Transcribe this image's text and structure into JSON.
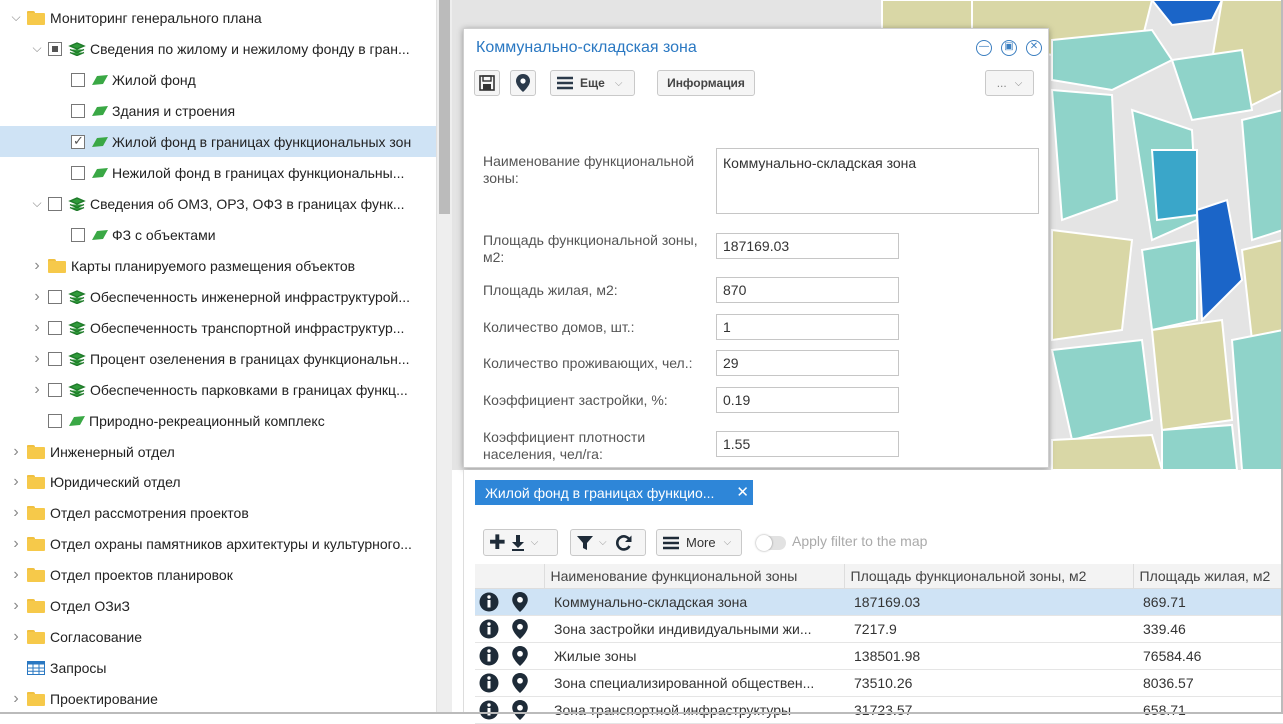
{
  "tree": {
    "items": [
      {
        "label": "Мониторинг генерального плана"
      },
      {
        "label": "Сведения по жилому и нежилому фонду в гран..."
      },
      {
        "label": "Жилой фонд"
      },
      {
        "label": "Здания и строения"
      },
      {
        "label": "Жилой фонд в границах функциональных зон"
      },
      {
        "label": "Нежилой фонд в границах функциональны..."
      },
      {
        "label": "Сведения об ОМЗ, ОРЗ, ОФЗ в границах функ..."
      },
      {
        "label": "ФЗ с объектами"
      },
      {
        "label": "Карты планируемого размещения объектов"
      },
      {
        "label": "Обеспеченность инженерной инфраструктурой..."
      },
      {
        "label": "Обеспеченность транспортной инфраструктур..."
      },
      {
        "label": "Процент озеленения в границах функциональн..."
      },
      {
        "label": "Обеспеченность парковками в границах функц..."
      },
      {
        "label": "Природно-рекреационный комплекс"
      },
      {
        "label": "Инженерный отдел"
      },
      {
        "label": "Юридический отдел"
      },
      {
        "label": "Отдел рассмотрения проектов"
      },
      {
        "label": "Отдел охраны памятников архитектуры и культурного..."
      },
      {
        "label": "Отдел проектов планировок"
      },
      {
        "label": "Отдел ОЗиЗ"
      },
      {
        "label": "Согласование"
      },
      {
        "label": "Запросы"
      },
      {
        "label": "Проектирование"
      }
    ]
  },
  "popup": {
    "title": "Коммунально-складская зона",
    "toolbar": {
      "more_label": "Еще",
      "info_label": "Информация",
      "dots_label": "..."
    },
    "fields": [
      {
        "label": "Наименование функциональной зоны:",
        "value": "Коммунально-складская зона"
      },
      {
        "label": "Площадь функциональной зоны, м2:",
        "value": "187169.03"
      },
      {
        "label": "Площадь жилая, м2:",
        "value": "870"
      },
      {
        "label": "Количество домов, шт.:",
        "value": "1"
      },
      {
        "label": "Количество проживающих, чел.:",
        "value": "29"
      },
      {
        "label": "Коэффициент застройки, %:",
        "value": "0.19"
      },
      {
        "label": "Коэффициент плотности населения, чел/га:",
        "value": "1.55"
      }
    ]
  },
  "grid": {
    "tab_label": "Жилой фонд в границах функцио...",
    "toolbar": {
      "more_label": "More",
      "apply_filter_label": "Apply filter to the map"
    },
    "columns": [
      "Наименование функциональной зоны",
      "Площадь функциональной зоны, м2",
      "Площадь жилая, м2"
    ],
    "rows": [
      {
        "name": "Коммунально-складская зона",
        "area": "187169.03",
        "living": "869.71"
      },
      {
        "name": "Зона застройки индивидуальными жи...",
        "area": "7217.9",
        "living": "339.46"
      },
      {
        "name": "Жилые зоны",
        "area": "138501.98",
        "living": "76584.46"
      },
      {
        "name": "Зона специализированной обществен...",
        "area": "73510.26",
        "living": "8036.57"
      },
      {
        "name": "Зона транспортной инфраструктуры",
        "area": "31723.57",
        "living": "658.71"
      }
    ]
  },
  "colors": {
    "accent": "#2a78c2",
    "tab": "#2e86d8",
    "selection": "#cfe3f5",
    "map_teal": "#8fd3c9",
    "map_khaki": "#d9d7a6",
    "map_blue": "#1b65c8"
  }
}
